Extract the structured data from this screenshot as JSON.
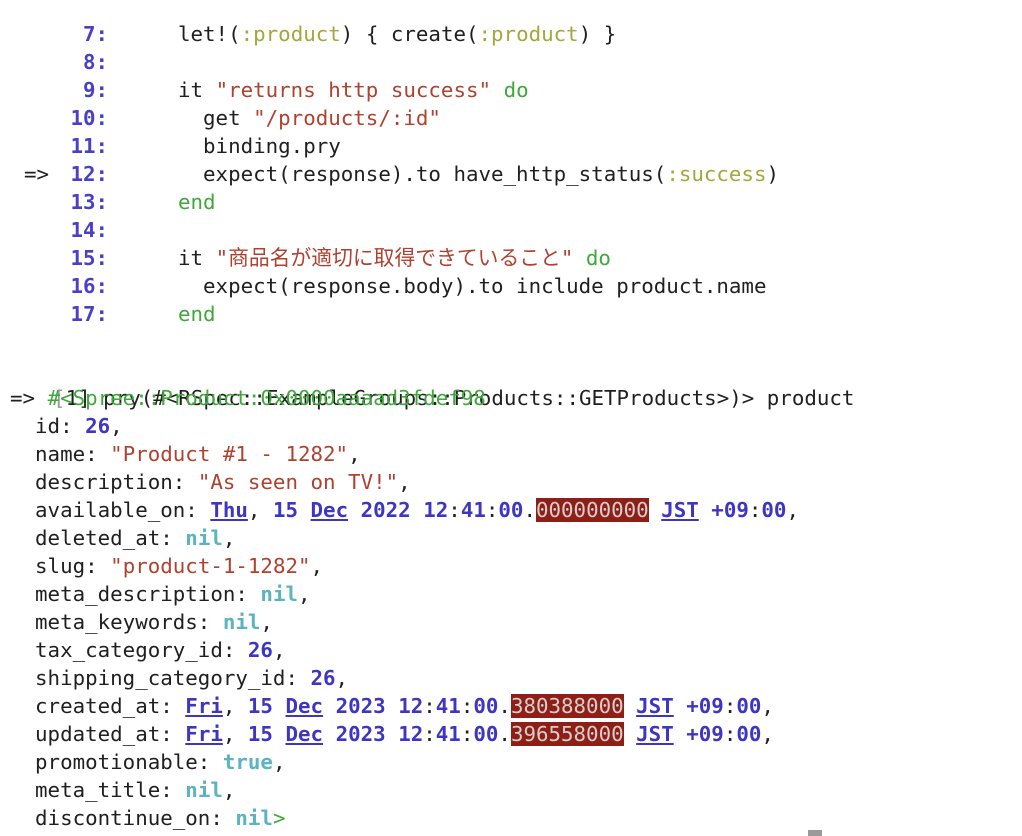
{
  "code_lines": [
    {
      "arrow": "",
      "num": "7:",
      "tokens": [
        {
          "t": "let!(",
          "c": ""
        },
        {
          "t": ":product",
          "c": "sym"
        },
        {
          "t": ") { create(",
          "c": ""
        },
        {
          "t": ":product",
          "c": "sym"
        },
        {
          "t": ") }",
          "c": ""
        }
      ]
    },
    {
      "arrow": "",
      "num": "8:",
      "tokens": []
    },
    {
      "arrow": "",
      "num": "9:",
      "tokens": [
        {
          "t": "it ",
          "c": ""
        },
        {
          "t": "\"returns http success\"",
          "c": "str"
        },
        {
          "t": " ",
          "c": ""
        },
        {
          "t": "do",
          "c": "kw"
        }
      ]
    },
    {
      "arrow": "",
      "num": "10:",
      "tokens": [
        {
          "t": "  get ",
          "c": ""
        },
        {
          "t": "\"/products/:id\"",
          "c": "str"
        }
      ]
    },
    {
      "arrow": "",
      "num": "11:",
      "tokens": [
        {
          "t": "  binding.pry",
          "c": ""
        }
      ]
    },
    {
      "arrow": "=>",
      "num": "12:",
      "tokens": [
        {
          "t": "  expect(response).to have_http_status(",
          "c": ""
        },
        {
          "t": ":success",
          "c": "sym"
        },
        {
          "t": ")",
          "c": ""
        }
      ]
    },
    {
      "arrow": "",
      "num": "13:",
      "tokens": [
        {
          "t": "end",
          "c": "kw"
        }
      ]
    },
    {
      "arrow": "",
      "num": "14:",
      "tokens": []
    },
    {
      "arrow": "",
      "num": "15:",
      "tokens": [
        {
          "t": "it ",
          "c": ""
        },
        {
          "t": "\"商品名が適切に取得できていること\"",
          "c": "str"
        },
        {
          "t": " ",
          "c": ""
        },
        {
          "t": "do",
          "c": "kw"
        }
      ]
    },
    {
      "arrow": "",
      "num": "16:",
      "tokens": [
        {
          "t": "  expect(response.body).to include product.name",
          "c": ""
        }
      ]
    },
    {
      "arrow": "",
      "num": "17:",
      "tokens": [
        {
          "t": "end",
          "c": "kw"
        }
      ]
    }
  ],
  "prompt": {
    "bracket": "[",
    "text": "[1] pry(#<RSpec::ExampleGroups::Products::GETProducts>)> product"
  },
  "result_lines": [
    [
      {
        "t": "=> ",
        "c": ""
      },
      {
        "t": "#<Spree::Product:0x0000aaaad3fdef98",
        "c": "cls"
      }
    ],
    [
      {
        "t": "  id: ",
        "c": ""
      },
      {
        "t": "26",
        "c": "num"
      },
      {
        "t": ",",
        "c": ""
      }
    ],
    [
      {
        "t": "  name: ",
        "c": ""
      },
      {
        "t": "\"Product #1 - 1282\"",
        "c": "str"
      },
      {
        "t": ",",
        "c": ""
      }
    ],
    [
      {
        "t": "  description: ",
        "c": ""
      },
      {
        "t": "\"As seen on TV!\"",
        "c": "str"
      },
      {
        "t": ",",
        "c": ""
      }
    ],
    [
      {
        "t": "  available_on: ",
        "c": ""
      },
      {
        "t": "Thu",
        "c": "date"
      },
      {
        "t": ", ",
        "c": ""
      },
      {
        "t": "15",
        "c": "num"
      },
      {
        "t": " ",
        "c": ""
      },
      {
        "t": "Dec",
        "c": "date"
      },
      {
        "t": " ",
        "c": ""
      },
      {
        "t": "2022",
        "c": "num"
      },
      {
        "t": " ",
        "c": ""
      },
      {
        "t": "12",
        "c": "num"
      },
      {
        "t": ":",
        "c": ""
      },
      {
        "t": "41",
        "c": "num"
      },
      {
        "t": ":",
        "c": ""
      },
      {
        "t": "00",
        "c": "num"
      },
      {
        "t": ".",
        "c": ""
      },
      {
        "t": "000000000",
        "c": "hl"
      },
      {
        "t": " ",
        "c": ""
      },
      {
        "t": "JST",
        "c": "date"
      },
      {
        "t": " ",
        "c": ""
      },
      {
        "t": "+09",
        "c": "num"
      },
      {
        "t": ":",
        "c": ""
      },
      {
        "t": "00",
        "c": "num"
      },
      {
        "t": ",",
        "c": ""
      }
    ],
    [
      {
        "t": "  deleted_at: ",
        "c": ""
      },
      {
        "t": "nil",
        "c": "nilc"
      },
      {
        "t": ",",
        "c": ""
      }
    ],
    [
      {
        "t": "  slug: ",
        "c": ""
      },
      {
        "t": "\"product-1-1282\"",
        "c": "str"
      },
      {
        "t": ",",
        "c": ""
      }
    ],
    [
      {
        "t": "  meta_description: ",
        "c": ""
      },
      {
        "t": "nil",
        "c": "nilc"
      },
      {
        "t": ",",
        "c": ""
      }
    ],
    [
      {
        "t": "  meta_keywords: ",
        "c": ""
      },
      {
        "t": "nil",
        "c": "nilc"
      },
      {
        "t": ",",
        "c": ""
      }
    ],
    [
      {
        "t": "  tax_category_id: ",
        "c": ""
      },
      {
        "t": "26",
        "c": "num"
      },
      {
        "t": ",",
        "c": ""
      }
    ],
    [
      {
        "t": "  shipping_category_id: ",
        "c": ""
      },
      {
        "t": "26",
        "c": "num"
      },
      {
        "t": ",",
        "c": ""
      }
    ],
    [
      {
        "t": "  created_at: ",
        "c": ""
      },
      {
        "t": "Fri",
        "c": "date"
      },
      {
        "t": ", ",
        "c": ""
      },
      {
        "t": "15",
        "c": "num"
      },
      {
        "t": " ",
        "c": ""
      },
      {
        "t": "Dec",
        "c": "date"
      },
      {
        "t": " ",
        "c": ""
      },
      {
        "t": "2023",
        "c": "num"
      },
      {
        "t": " ",
        "c": ""
      },
      {
        "t": "12",
        "c": "num"
      },
      {
        "t": ":",
        "c": ""
      },
      {
        "t": "41",
        "c": "num"
      },
      {
        "t": ":",
        "c": ""
      },
      {
        "t": "00",
        "c": "num"
      },
      {
        "t": ".",
        "c": ""
      },
      {
        "t": "380388000",
        "c": "hl"
      },
      {
        "t": " ",
        "c": ""
      },
      {
        "t": "JST",
        "c": "date"
      },
      {
        "t": " ",
        "c": ""
      },
      {
        "t": "+09",
        "c": "num"
      },
      {
        "t": ":",
        "c": ""
      },
      {
        "t": "00",
        "c": "num"
      },
      {
        "t": ",",
        "c": ""
      }
    ],
    [
      {
        "t": "  updated_at: ",
        "c": ""
      },
      {
        "t": "Fri",
        "c": "date"
      },
      {
        "t": ", ",
        "c": ""
      },
      {
        "t": "15",
        "c": "num"
      },
      {
        "t": " ",
        "c": ""
      },
      {
        "t": "Dec",
        "c": "date"
      },
      {
        "t": " ",
        "c": ""
      },
      {
        "t": "2023",
        "c": "num"
      },
      {
        "t": " ",
        "c": ""
      },
      {
        "t": "12",
        "c": "num"
      },
      {
        "t": ":",
        "c": ""
      },
      {
        "t": "41",
        "c": "num"
      },
      {
        "t": ":",
        "c": ""
      },
      {
        "t": "00",
        "c": "num"
      },
      {
        "t": ".",
        "c": ""
      },
      {
        "t": "396558000",
        "c": "hl"
      },
      {
        "t": " ",
        "c": ""
      },
      {
        "t": "JST",
        "c": "date"
      },
      {
        "t": " ",
        "c": ""
      },
      {
        "t": "+09",
        "c": "num"
      },
      {
        "t": ":",
        "c": ""
      },
      {
        "t": "00",
        "c": "num"
      },
      {
        "t": ",",
        "c": ""
      }
    ],
    [
      {
        "t": "  promotionable: ",
        "c": ""
      },
      {
        "t": "true",
        "c": "nilc"
      },
      {
        "t": ",",
        "c": ""
      }
    ],
    [
      {
        "t": "  meta_title: ",
        "c": ""
      },
      {
        "t": "nil",
        "c": "nilc"
      },
      {
        "t": ",",
        "c": ""
      }
    ],
    [
      {
        "t": "  discontinue_on: ",
        "c": ""
      },
      {
        "t": "nil",
        "c": "nilc"
      },
      {
        "t": ">",
        "c": "kw"
      }
    ]
  ],
  "colors": {
    "line_number": "#4a3fc9",
    "string": "#b0412f",
    "keyword": "#3fa83a",
    "symbol": "#a3a83a",
    "number": "#3e35c2",
    "nil": "#5bb4c0",
    "highlight_bg": "#8f1f16"
  }
}
